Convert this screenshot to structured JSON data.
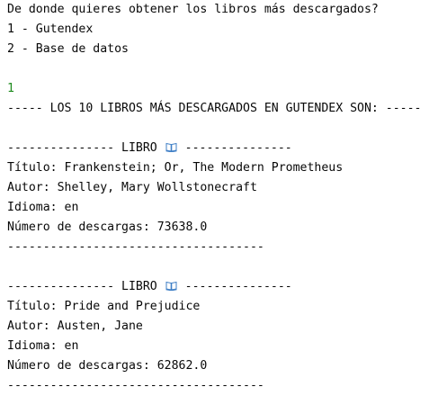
{
  "console": {
    "prompt_question": "De donde quieres obtener los libros más descargados?",
    "option_1": "1 - Gutendex",
    "option_2": "2 - Base de datos",
    "user_input": "1",
    "header": "----- LOS 10 LIBROS MÁS DESCARGADOS EN GUTENDEX SON: -----",
    "book_header_left": "--------------- LIBRO",
    "book_header_right": "---------------",
    "book_icon": "open-book-icon",
    "separator": "------------------------------------",
    "books": [
      {
        "titulo": "Título: Frankenstein; Or, The Modern Prometheus",
        "autor": "Autor: Shelley, Mary Wollstonecraft",
        "idioma": "Idioma: en",
        "descargas": "Número de descargas: 73638.0"
      },
      {
        "titulo": "Título: Pride and Prejudice",
        "autor": "Autor: Austen, Jane",
        "idioma": "Idioma: en",
        "descargas": "Número de descargas: 62862.0"
      }
    ]
  },
  "colors": {
    "text": "#080808",
    "input": "#1e8a1e",
    "background": "#ffffff",
    "icon_blue": "#3f7fc6"
  }
}
